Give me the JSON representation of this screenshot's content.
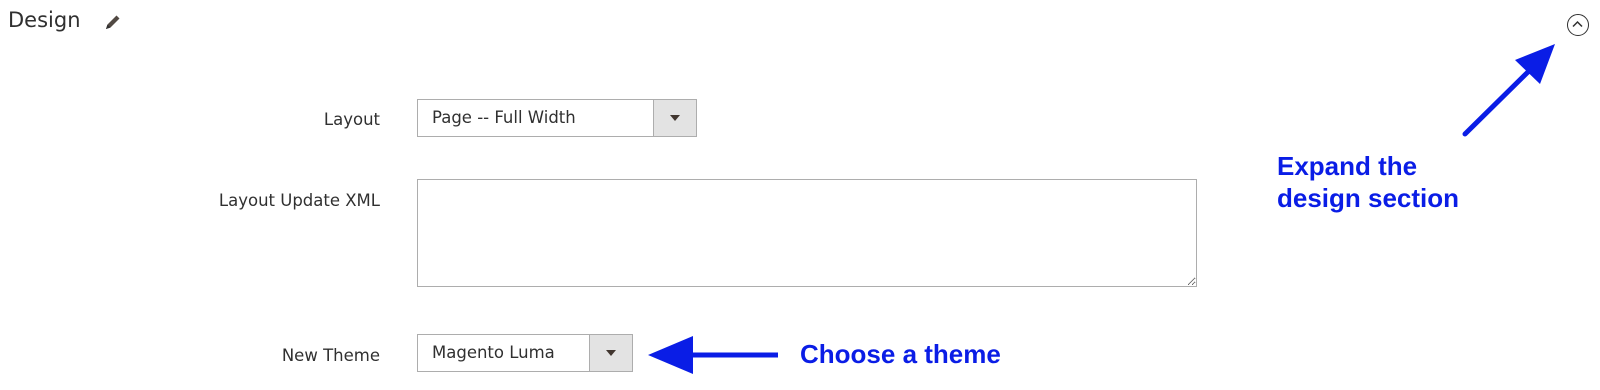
{
  "section": {
    "title": "Design",
    "edit_icon": "pencil-icon",
    "collapse_icon": "chevron-up-circle-icon"
  },
  "fields": {
    "layout": {
      "label": "Layout",
      "value": "Page -- Full Width"
    },
    "layout_update_xml": {
      "label": "Layout Update XML",
      "value": ""
    },
    "new_theme": {
      "label": "New Theme",
      "value": "Magento Luma"
    }
  },
  "annotations": {
    "expand": {
      "line1": "Expand the",
      "line2": "design section"
    },
    "theme": "Choose a theme"
  },
  "colors": {
    "annotation": "#0a1de6",
    "text": "#303030",
    "border": "#adadad",
    "caret_bg": "#e3e3e3"
  }
}
